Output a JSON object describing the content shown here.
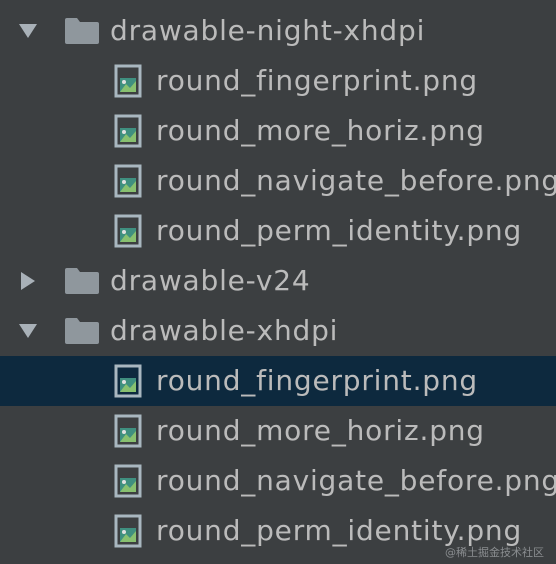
{
  "tree": {
    "items": [
      {
        "kind": "folder",
        "label": "drawable-night-xhdpi",
        "expanded": true
      },
      {
        "kind": "file",
        "label": "round_fingerprint.png"
      },
      {
        "kind": "file",
        "label": "round_more_horiz.png"
      },
      {
        "kind": "file",
        "label": "round_navigate_before.png"
      },
      {
        "kind": "file",
        "label": "round_perm_identity.png"
      },
      {
        "kind": "folder",
        "label": "drawable-v24",
        "expanded": false
      },
      {
        "kind": "folder",
        "label": "drawable-xhdpi",
        "expanded": true
      },
      {
        "kind": "file",
        "label": "round_fingerprint.png",
        "selected": true
      },
      {
        "kind": "file",
        "label": "round_more_horiz.png"
      },
      {
        "kind": "file",
        "label": "round_navigate_before.png"
      },
      {
        "kind": "file",
        "label": "round_perm_identity.png"
      }
    ]
  },
  "colors": {
    "background": "#3c3f41",
    "selection": "#0d293e",
    "text": "#bbbbbb",
    "folder": "#8f979d"
  },
  "icons": {
    "folder": "folder-icon",
    "file": "image-file-icon",
    "expanded": "chevron-down-icon",
    "collapsed": "chevron-right-icon"
  },
  "watermark": "@稀土掘金技术社区"
}
